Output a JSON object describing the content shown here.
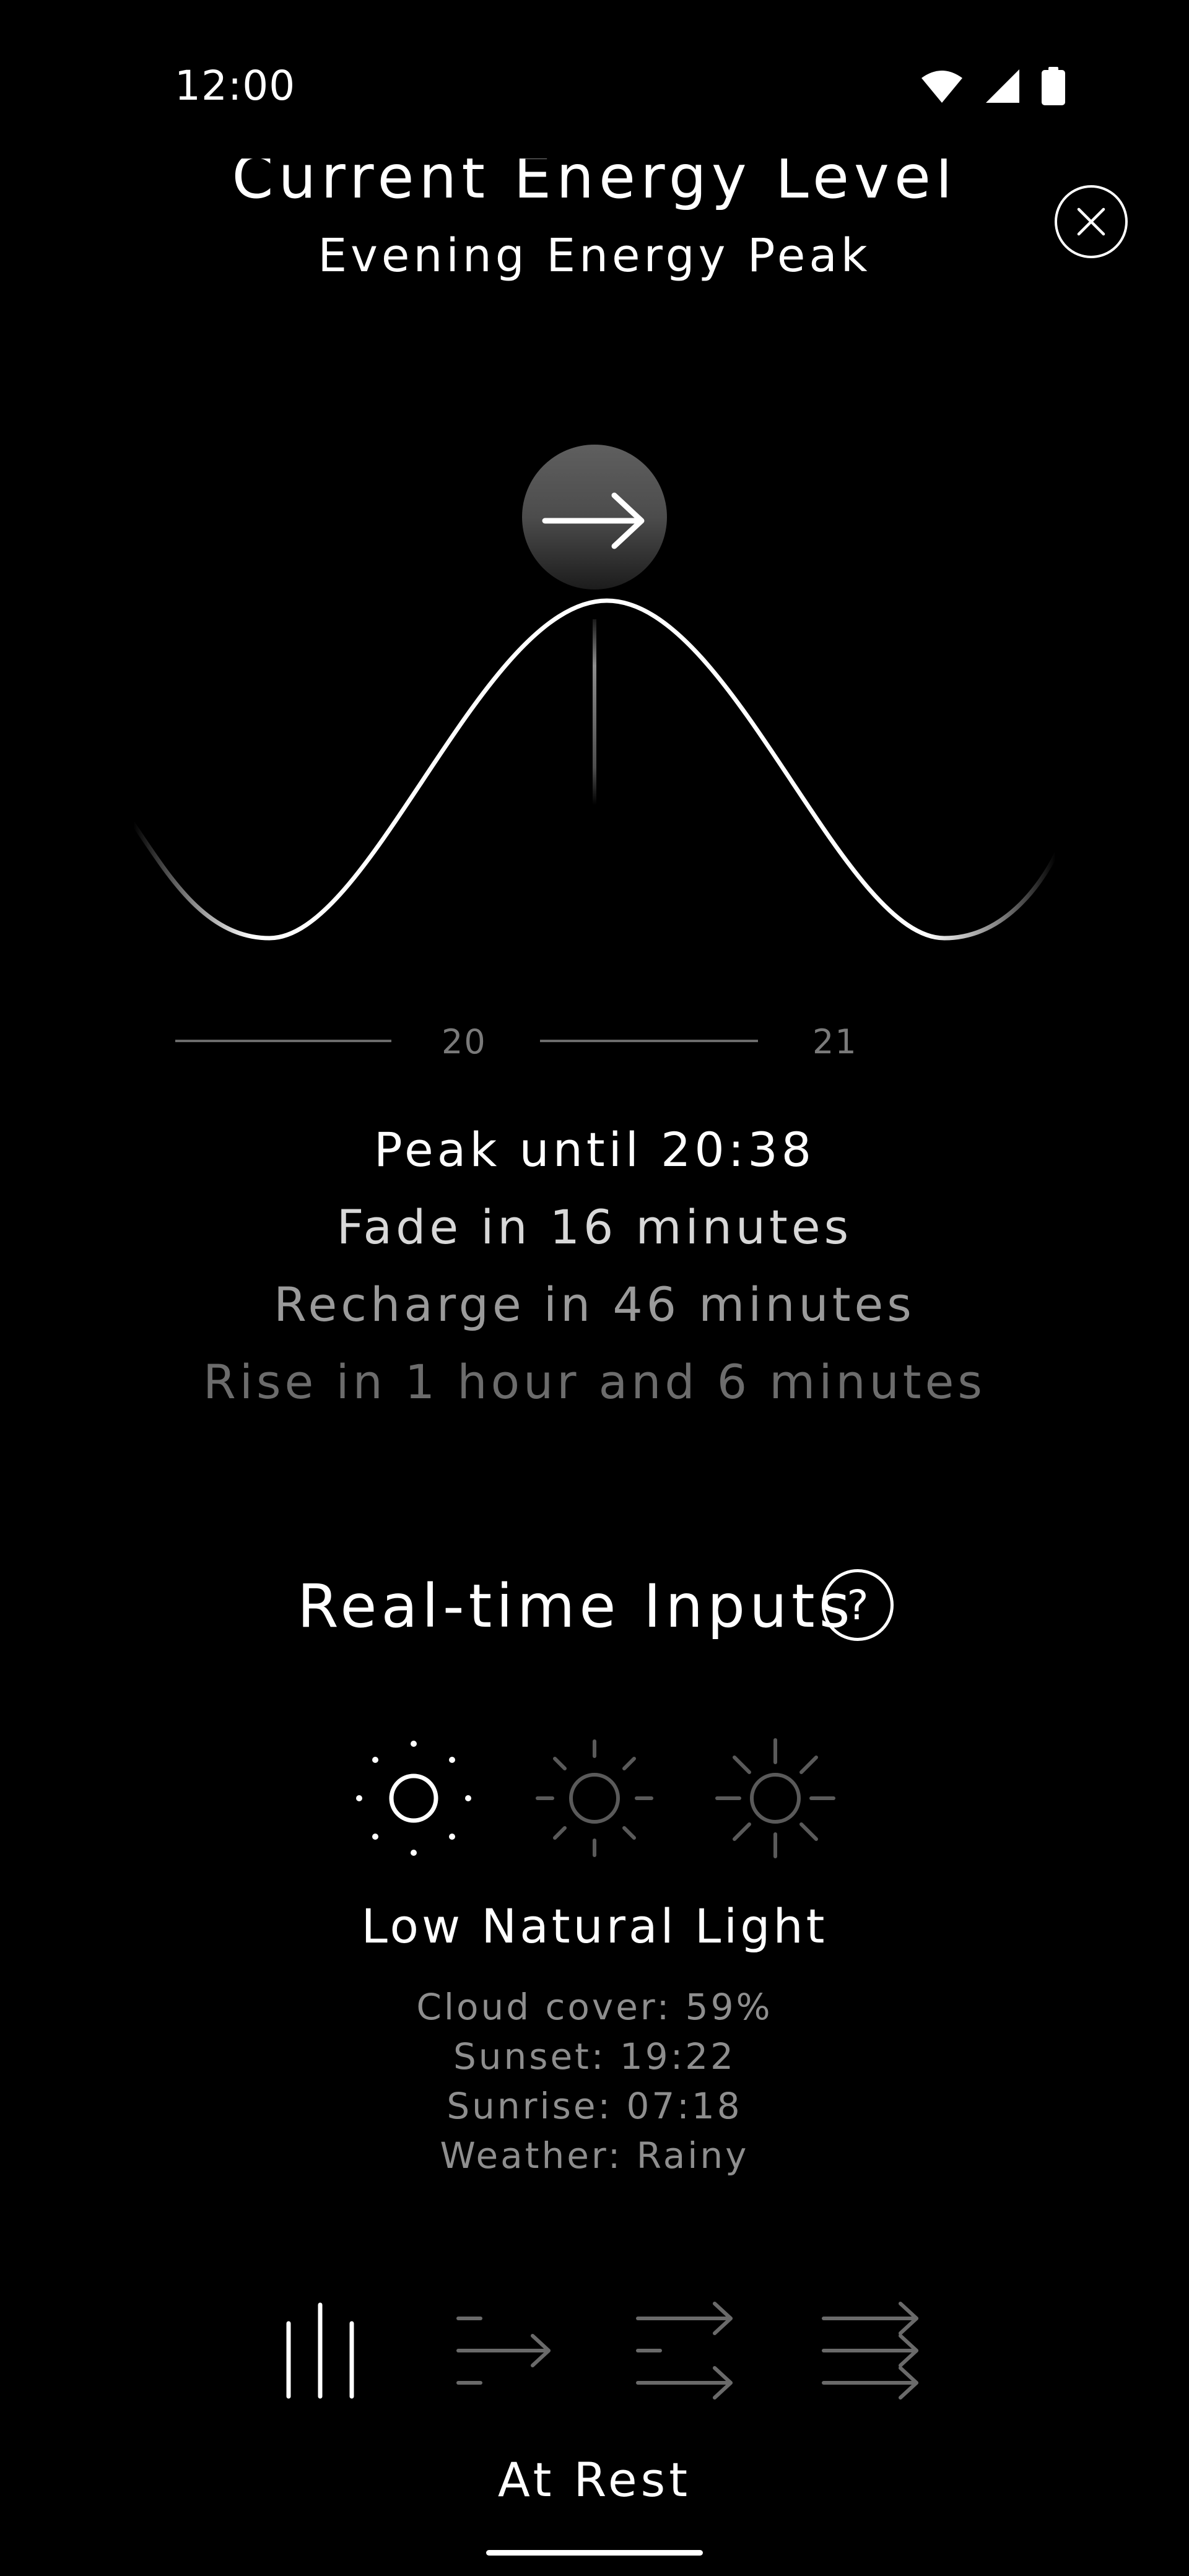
{
  "status_bar": {
    "time": "12:00",
    "icons": [
      "wifi-icon",
      "cellular-signal-icon",
      "battery-icon"
    ]
  },
  "header": {
    "title": "Current Energy Level",
    "subtitle": "Evening Energy Peak",
    "close_icon": "close-icon"
  },
  "chart_data": {
    "type": "line",
    "x_ticks": [
      "20",
      "21"
    ],
    "description_marker": "current-time-marker",
    "marker_icon": "arrow-right-icon"
  },
  "timeline": {
    "peak": "Peak until 20:38",
    "fade": "Fade in 16 minutes",
    "recharge": "Recharge in 46 minutes",
    "rise": "Rise in 1 hour and 6 minutes"
  },
  "inputs": {
    "heading": "Real-time Inputs",
    "help_symbol": "?",
    "light_levels": [
      {
        "icon": "sun-low-icon",
        "active": true
      },
      {
        "icon": "sun-medium-icon",
        "active": false
      },
      {
        "icon": "sun-high-icon",
        "active": false
      }
    ],
    "light_title": "Low Natural Light",
    "details": {
      "cloud_cover": "Cloud cover: 59%",
      "sunset": "Sunset: 19:22",
      "sunrise": "Sunrise: 07:18",
      "weather": "Weather: Rainy"
    }
  },
  "bottom_nav": {
    "items": [
      {
        "icon": "at-rest-icon",
        "active": true
      },
      {
        "icon": "single-arrow-icon",
        "active": false
      },
      {
        "icon": "double-arrow-icon",
        "active": false
      },
      {
        "icon": "triple-arrow-icon",
        "active": false
      }
    ],
    "active_label": "At Rest"
  },
  "colors": {
    "background": "#000000",
    "foreground": "#ffffff",
    "muted": "#7a7a7a"
  }
}
